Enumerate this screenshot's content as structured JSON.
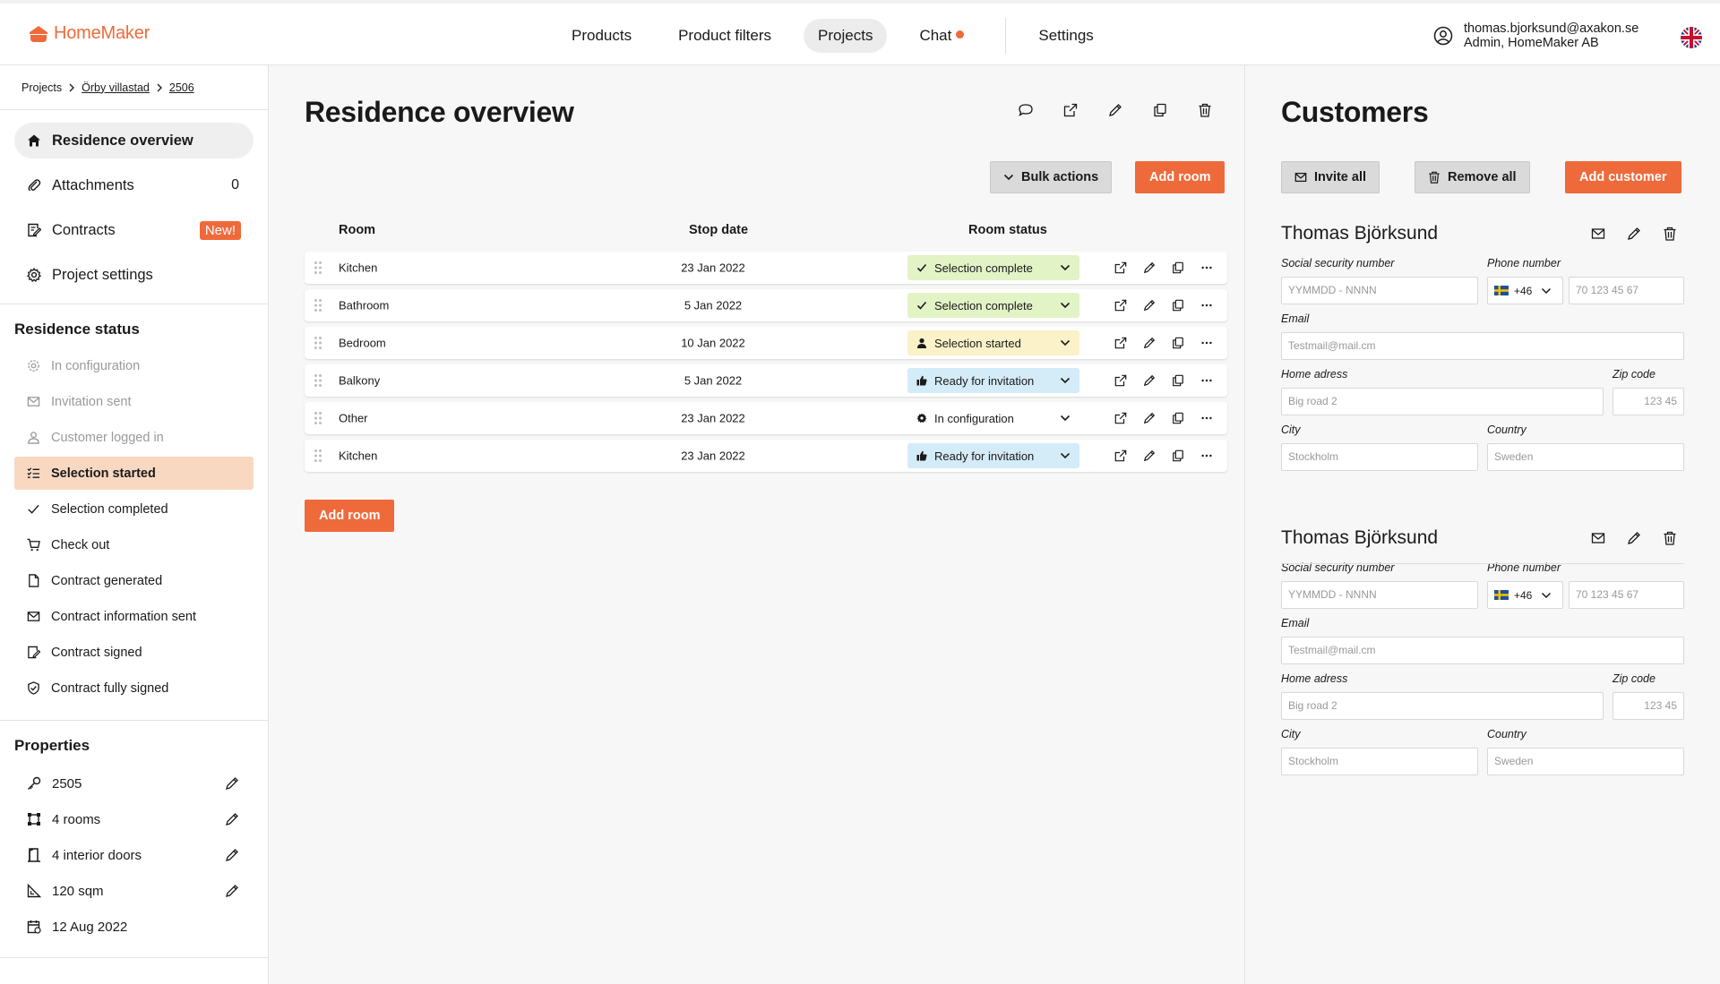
{
  "app": {
    "name": "HomeMaker"
  },
  "nav": [
    {
      "label": "Products",
      "active": false
    },
    {
      "label": "Product filters",
      "active": false
    },
    {
      "label": "Projects",
      "active": true
    },
    {
      "label": "Chat",
      "active": false
    },
    {
      "label": "Settings",
      "active": false
    }
  ],
  "user": {
    "email": "thomas.bjorksund@axakon.se",
    "role": "Admin, HomeMaker AB"
  },
  "breadcrumb": [
    "Projects",
    "Örby villastad",
    "2506"
  ],
  "sidebar": {
    "items": [
      {
        "label": "Residence overview",
        "icon": "home-icon"
      },
      {
        "label": "Attachments",
        "icon": "paperclip-icon",
        "count": "0"
      },
      {
        "label": "Contracts",
        "icon": "contract-icon",
        "badge": "New!"
      },
      {
        "label": "Project settings",
        "icon": "gear-icon"
      }
    ],
    "status_title": "Residence status",
    "statuses": [
      {
        "label": "In configuration",
        "icon": "gear-icon",
        "state": "muted"
      },
      {
        "label": "Invitation sent",
        "icon": "mail-icon",
        "state": "muted"
      },
      {
        "label": "Customer logged in",
        "icon": "person-icon",
        "state": "muted"
      },
      {
        "label": "Selection started",
        "icon": "checklist-icon",
        "state": "active"
      },
      {
        "label": "Selection completed",
        "icon": "check-icon",
        "state": "normal"
      },
      {
        "label": "Check out",
        "icon": "cart-icon",
        "state": "normal"
      },
      {
        "label": "Contract generated",
        "icon": "document-icon",
        "state": "normal"
      },
      {
        "label": "Contract information sent",
        "icon": "mail-icon",
        "state": "normal"
      },
      {
        "label": "Contract signed",
        "icon": "contract-icon",
        "state": "normal"
      },
      {
        "label": "Contract fully signed",
        "icon": "shield-check-icon",
        "state": "normal"
      }
    ],
    "properties_title": "Properties",
    "properties": [
      {
        "label": "2505",
        "icon": "key-icon",
        "editable": true
      },
      {
        "label": "4 rooms",
        "icon": "rooms-icon",
        "editable": true
      },
      {
        "label": "4 interior doors",
        "icon": "door-icon",
        "editable": true
      },
      {
        "label": "120 sqm",
        "icon": "ruler-icon",
        "editable": true
      },
      {
        "label": "12 Aug 2022",
        "icon": "calendar-icon",
        "editable": false
      }
    ]
  },
  "main": {
    "title": "Residence overview",
    "bulk_label": "Bulk actions",
    "add_room_label": "Add room",
    "columns": [
      "Room",
      "Stop date",
      "Room status"
    ],
    "rooms": [
      {
        "name": "Kitchen",
        "date": "23 Jan 2022",
        "status": "Selection complete",
        "kind": "complete"
      },
      {
        "name": "Bathroom",
        "date": "5 Jan 2022",
        "status": "Selection complete",
        "kind": "complete"
      },
      {
        "name": "Bedroom",
        "date": "10 Jan 2022",
        "status": "Selection started",
        "kind": "started"
      },
      {
        "name": "Balkony",
        "date": "5 Jan 2022",
        "status": "Ready for invitation",
        "kind": "ready"
      },
      {
        "name": "Other",
        "date": "23 Jan 2022",
        "status": "In configuration",
        "kind": "config"
      },
      {
        "name": "Kitchen",
        "date": "23 Jan 2022",
        "status": "Ready for invitation",
        "kind": "ready"
      }
    ]
  },
  "customers_panel": {
    "title": "Customers",
    "invite_all": "Invite all",
    "remove_all": "Remove all",
    "add_customer": "Add customer",
    "customers": [
      {
        "name": "Thomas Björksund",
        "ssn_label": "Social security number",
        "ssn_placeholder": "YYMMDD - NNNN",
        "phone_label": "Phone number",
        "phone_prefix": "+46",
        "phone_placeholder": "70 123 45 67",
        "email_label": "Email",
        "email_placeholder": "Testmail@mail.cm",
        "address_label": "Home adress",
        "address_placeholder": "Big road 2",
        "zip_label": "Zip code",
        "zip_placeholder": "123 45",
        "city_label": "City",
        "city_placeholder": "Stockholm",
        "country_label": "Country",
        "country_placeholder": "Sweden"
      },
      {
        "name": "Thomas Björksund",
        "ssn_label": "Social security number",
        "ssn_placeholder": "YYMMDD - NNNN",
        "phone_label": "Phone number",
        "phone_prefix": "+46",
        "phone_placeholder": "70 123 45 67",
        "email_label": "Email",
        "email_placeholder": "Testmail@mail.cm",
        "address_label": "Home adress",
        "address_placeholder": "Big road 2",
        "zip_label": "Zip code",
        "zip_placeholder": "123 45",
        "city_label": "City",
        "city_placeholder": "Stockholm",
        "country_label": "Country",
        "country_placeholder": "Sweden"
      }
    ]
  },
  "colors": {
    "accent": "#ef6a3b",
    "complete": "#e2f3c6",
    "started": "#fbf2c9",
    "ready": "#d4ebf8",
    "active_status": "#f9d8c2"
  }
}
